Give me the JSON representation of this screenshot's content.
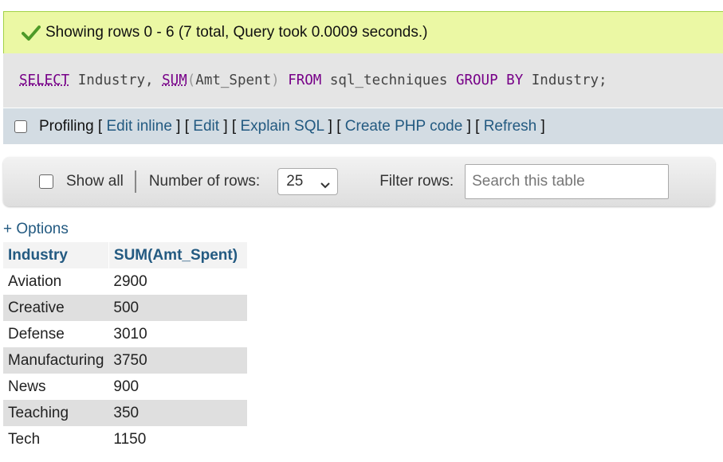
{
  "status": {
    "message": "Showing rows 0 - 6 (7 total, Query took 0.0009 seconds.)",
    "icon": "checkmark-icon",
    "color": "#ebf8a4"
  },
  "sql": {
    "select": "SELECT",
    "part1": " Industry, ",
    "sum": "SUM",
    "open": "(",
    "arg": "Amt_Spent",
    "close": ")",
    "sp1": " ",
    "from": "FROM",
    "table": " sql_techniques ",
    "groupby": "GROUP BY",
    "tail": " Industry;"
  },
  "profiling": {
    "label": "Profiling",
    "links": [
      "Edit inline",
      "Edit",
      "Explain SQL",
      "Create PHP code",
      "Refresh"
    ]
  },
  "nav": {
    "show_all": "Show all",
    "rows_label": "Number of rows:",
    "rows_value": "25",
    "filter_label": "Filter rows:",
    "search_placeholder": "Search this table"
  },
  "options_link": "+ Options",
  "table": {
    "headers": [
      "Industry",
      "SUM(Amt_Spent)"
    ],
    "rows": [
      [
        "Aviation",
        "2900"
      ],
      [
        "Creative",
        "500"
      ],
      [
        "Defense",
        "3010"
      ],
      [
        "Manufacturing",
        "3750"
      ],
      [
        "News",
        "900"
      ],
      [
        "Teaching",
        "350"
      ],
      [
        "Tech",
        "1150"
      ]
    ]
  },
  "colors": {
    "link": "#235a81",
    "keyword": "#770088",
    "profiling_bar": "#d3dce3"
  }
}
